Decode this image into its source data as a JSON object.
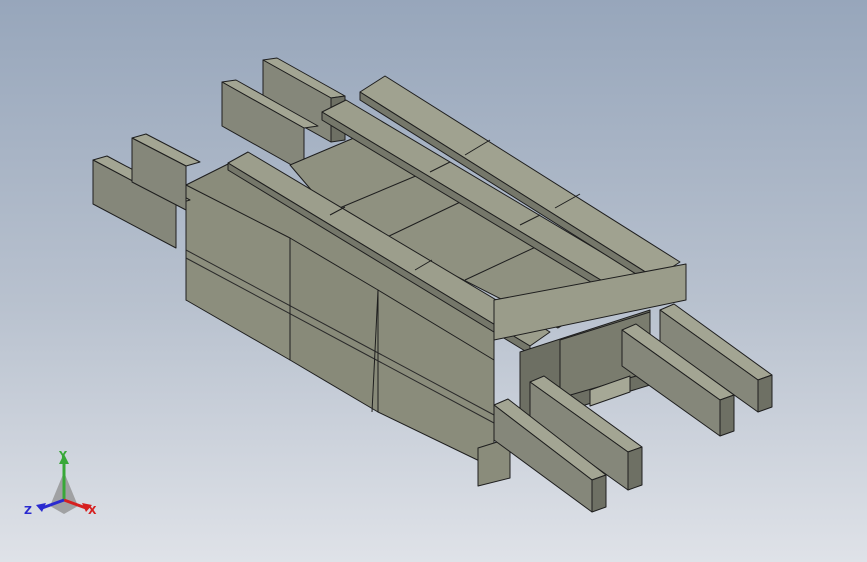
{
  "viewport": {
    "background_top": "#97a6bb",
    "background_bottom": "#dfe2e8",
    "model_color": "#8a8c7b",
    "edge_color": "#1e1e1e"
  },
  "triad": {
    "x_label": "X",
    "y_label": "Y",
    "z_label": "Z",
    "x_color": "#d62020",
    "y_color": "#38a838",
    "z_color": "#2a2ad0"
  }
}
